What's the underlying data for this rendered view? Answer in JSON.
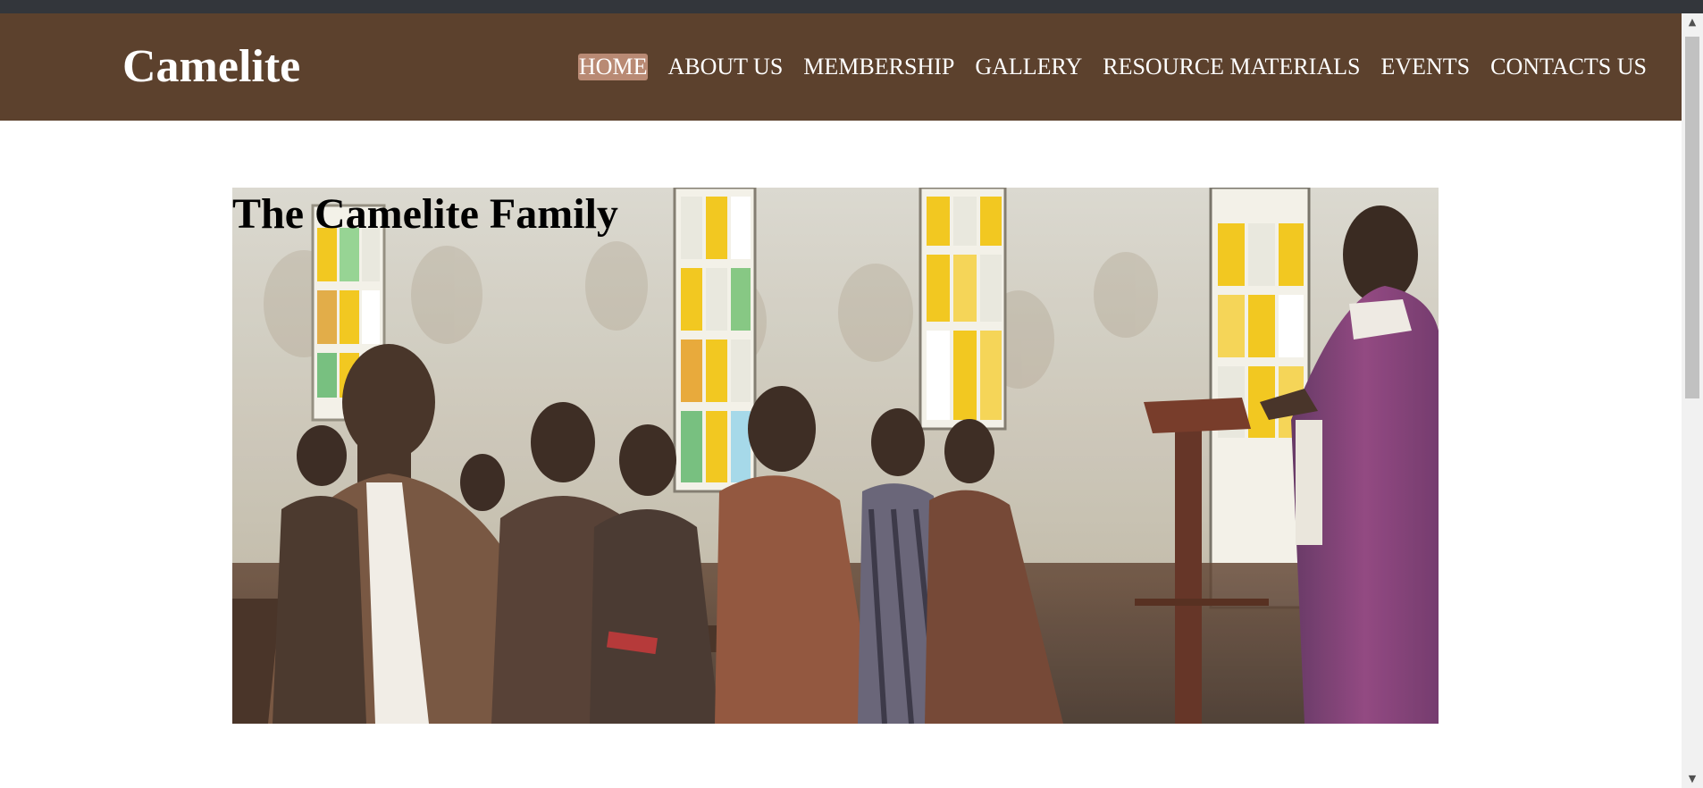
{
  "header": {
    "brand": "Camelite",
    "nav": [
      {
        "label": "HOME",
        "active": true
      },
      {
        "label": "ABOUT US",
        "active": false
      },
      {
        "label": "MEMBERSHIP",
        "active": false
      },
      {
        "label": "GALLERY",
        "active": false
      },
      {
        "label": "RESOURCE MATERIALS",
        "active": false
      },
      {
        "label": "EVENTS",
        "active": false
      },
      {
        "label": "CONTACTS US",
        "active": false
      }
    ]
  },
  "hero": {
    "title": "The Camelite Family",
    "image": "photo of church congregation seated in pews facing a priest at a wooden lectern, stained-glass windows behind"
  },
  "scrollbar": {
    "up_icon": "triangle-up-icon",
    "down_icon": "triangle-down-icon"
  },
  "colors": {
    "navbar": "#5c412d",
    "active_nav": "#b98a74",
    "top_strip": "#33363b",
    "nav_text": "#ffffff"
  }
}
